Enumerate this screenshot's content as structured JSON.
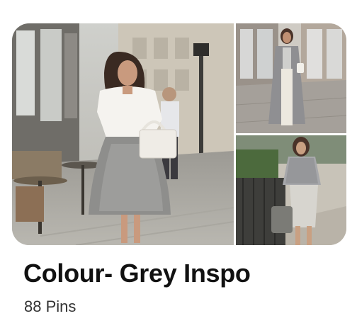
{
  "board": {
    "title": "Colour- Grey Inspo",
    "pin_count": "88 Pins"
  },
  "images": [
    {
      "name": "woman-grey-skirt-white-blouse-photo"
    },
    {
      "name": "woman-grey-long-coat-photo"
    },
    {
      "name": "woman-grey-pencil-skirt-photo"
    }
  ],
  "colors": {
    "title_text": "#111111",
    "count_text": "#333333"
  }
}
